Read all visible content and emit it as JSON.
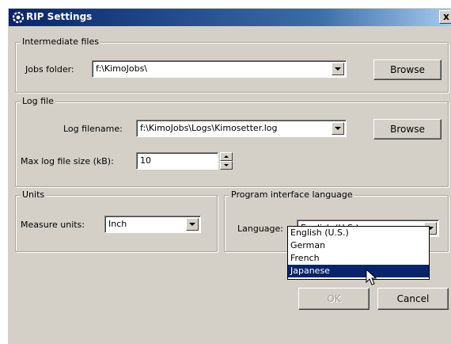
{
  "window": {
    "title": "RIP Settings",
    "close_label": "x"
  },
  "intermediate": {
    "legend": "Intermediate files",
    "jobs_label": "Jobs folder:",
    "jobs_value": "f:\\KimoJobs\\",
    "browse_label": "Browse"
  },
  "logfile": {
    "legend": "Log file",
    "filename_label": "Log filename:",
    "filename_value": "f:\\KimoJobs\\Logs\\Kimosetter.log",
    "browse_label": "Browse",
    "maxsize_label": "Max log file size (kB):",
    "maxsize_value": "10"
  },
  "units": {
    "legend": "Units",
    "measure_label": "Measure units:",
    "measure_value": "Inch"
  },
  "language": {
    "legend": "Program interface language",
    "label": "Language:",
    "value": "English (U.S.)",
    "options": [
      "English (U.S.)",
      "German",
      "French",
      "Japanese"
    ],
    "highlighted_index": 3
  },
  "buttons": {
    "ok_label": "OK",
    "cancel_label": "Cancel"
  },
  "icons": {
    "app": "gear-icon",
    "cursor": "mouse-pointer-icon"
  }
}
